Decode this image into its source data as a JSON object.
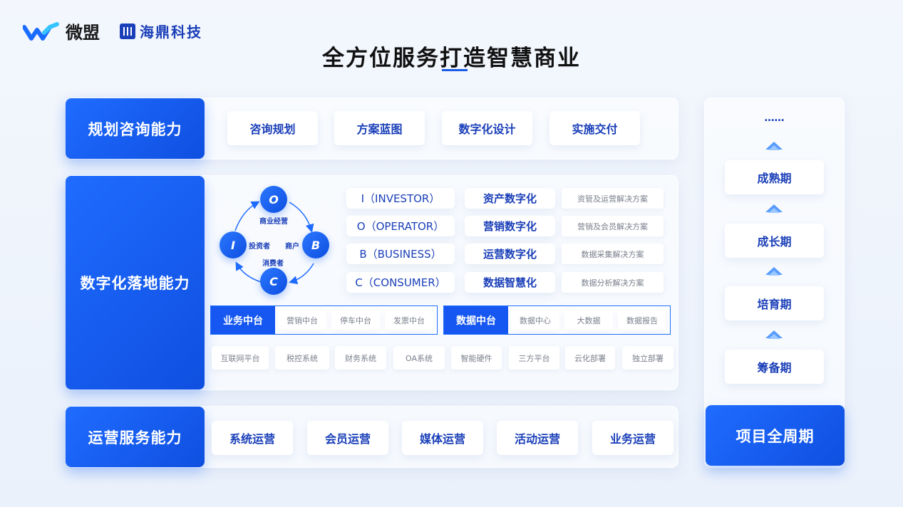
{
  "logos": {
    "weimeng": "微盟",
    "haiding": "海鼎科技"
  },
  "title": "全方位服务打造智慧商业",
  "planning": {
    "head": "规划咨询能力",
    "items": [
      "咨询规划",
      "方案蓝图",
      "数字化设计",
      "实施交付"
    ]
  },
  "digital": {
    "head": "数字化落地能力",
    "cycle": {
      "nodes": {
        "o": "O",
        "i": "I",
        "b": "B",
        "c": "C"
      },
      "labels": {
        "operator": "商业经营",
        "investor": "投资者",
        "merchant": "商户",
        "consumer": "消费者"
      }
    },
    "rows": [
      {
        "role": "I（INVESTOR）",
        "name": "资产数字化",
        "desc": "资管及运营解决方案"
      },
      {
        "role": "O（OPERATOR）",
        "name": "营销数字化",
        "desc": "营销及会员解决方案"
      },
      {
        "role": "B（BUSINESS）",
        "name": "运营数字化",
        "desc": "数据采集解决方案"
      },
      {
        "role": "C（CONSUMER）",
        "name": "数据智慧化",
        "desc": "数据分析解决方案"
      }
    ],
    "business_center": {
      "head": "业务中台",
      "items": [
        "营销中台",
        "停车中台",
        "发票中台"
      ]
    },
    "data_center": {
      "head": "数据中台",
      "items": [
        "数据中心",
        "大数据",
        "数据报告"
      ]
    },
    "systems": [
      "互联网平台",
      "税控系统",
      "财务系统",
      "OA系统",
      "智能硬件",
      "三方平台",
      "云化部署",
      "独立部署"
    ]
  },
  "operations": {
    "head": "运营服务能力",
    "items": [
      "系统运营",
      "会员运营",
      "媒体运营",
      "活动运营",
      "业务运营"
    ]
  },
  "lifecycle": {
    "dots": "……",
    "stages": [
      "成熟期",
      "成长期",
      "培育期",
      "筹备期"
    ],
    "head": "项目全周期"
  },
  "colors": {
    "primary": "#1f6cff",
    "deep": "#0f4fe0",
    "text_blue": "#1a3fb8"
  }
}
